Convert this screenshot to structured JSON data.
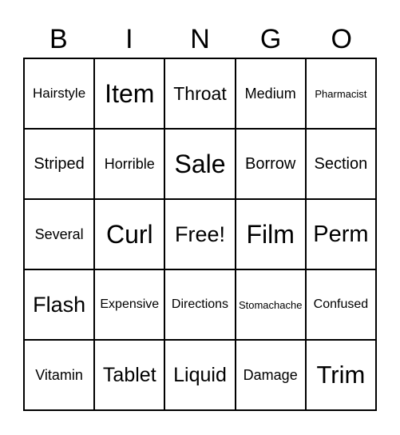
{
  "header": [
    "B",
    "I",
    "N",
    "G",
    "O"
  ],
  "cells": [
    [
      "Hairstyle",
      "Item",
      "Throat",
      "Medium",
      "Pharmacist"
    ],
    [
      "Striped",
      "Horrible",
      "Sale",
      "Borrow",
      "Section"
    ],
    [
      "Several",
      "Curl",
      "Free!",
      "Film",
      "Perm"
    ],
    [
      "Flash",
      "Expensive",
      "Directions",
      "Stomachache",
      "Confused"
    ],
    [
      "Vitamin",
      "Tablet",
      "Liquid",
      "Damage",
      "Trim"
    ]
  ]
}
